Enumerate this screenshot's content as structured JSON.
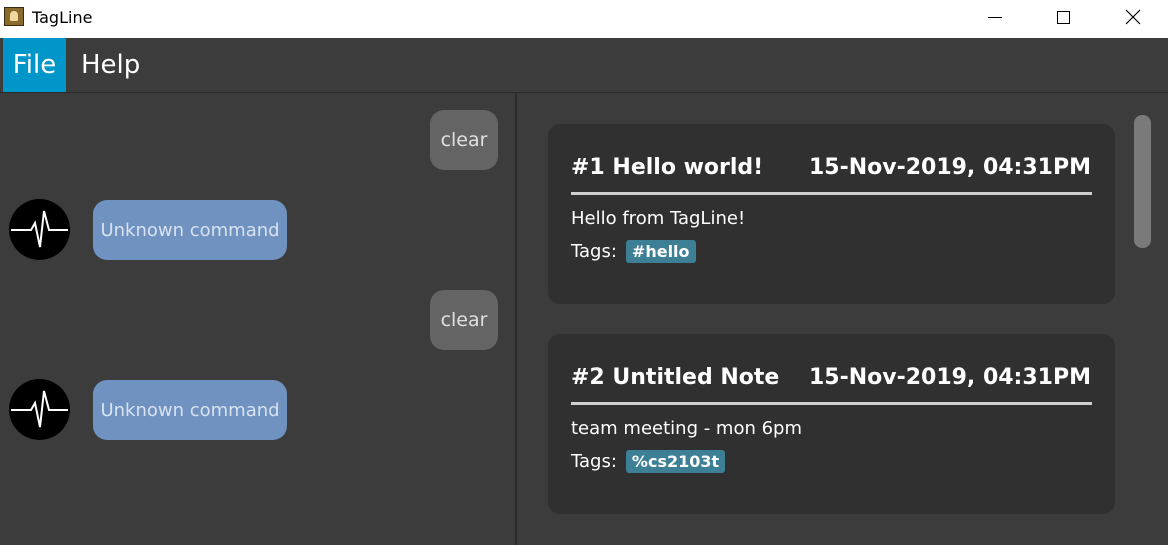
{
  "window": {
    "title": "TagLine",
    "icon": "app-icon"
  },
  "menu": {
    "items": [
      {
        "label": "File",
        "active": true
      },
      {
        "label": "Help",
        "active": false
      }
    ]
  },
  "chat": {
    "messages": [
      {
        "sender": "user",
        "text": "clear"
      },
      {
        "sender": "bot",
        "text": "Unknown command"
      },
      {
        "sender": "user",
        "text": "clear"
      },
      {
        "sender": "bot",
        "text": "Unknown command"
      }
    ]
  },
  "notes": [
    {
      "title": "#1 Hello world!",
      "timestamp": "15-Nov-2019, 04:31PM",
      "content": "Hello from TagLine!",
      "tags_label": "Tags:",
      "tags": [
        "#hello"
      ]
    },
    {
      "title": "#2 Untitled Note",
      "timestamp": "15-Nov-2019, 04:31PM",
      "content": "team meeting - mon 6pm",
      "tags_label": "Tags:",
      "tags": [
        "%cs2103t"
      ]
    }
  ],
  "colors": {
    "menu_active": "#0096c9",
    "bot_bubble": "#6f92c0",
    "user_bubble": "#646464",
    "tag_chip": "#3d7f94"
  }
}
